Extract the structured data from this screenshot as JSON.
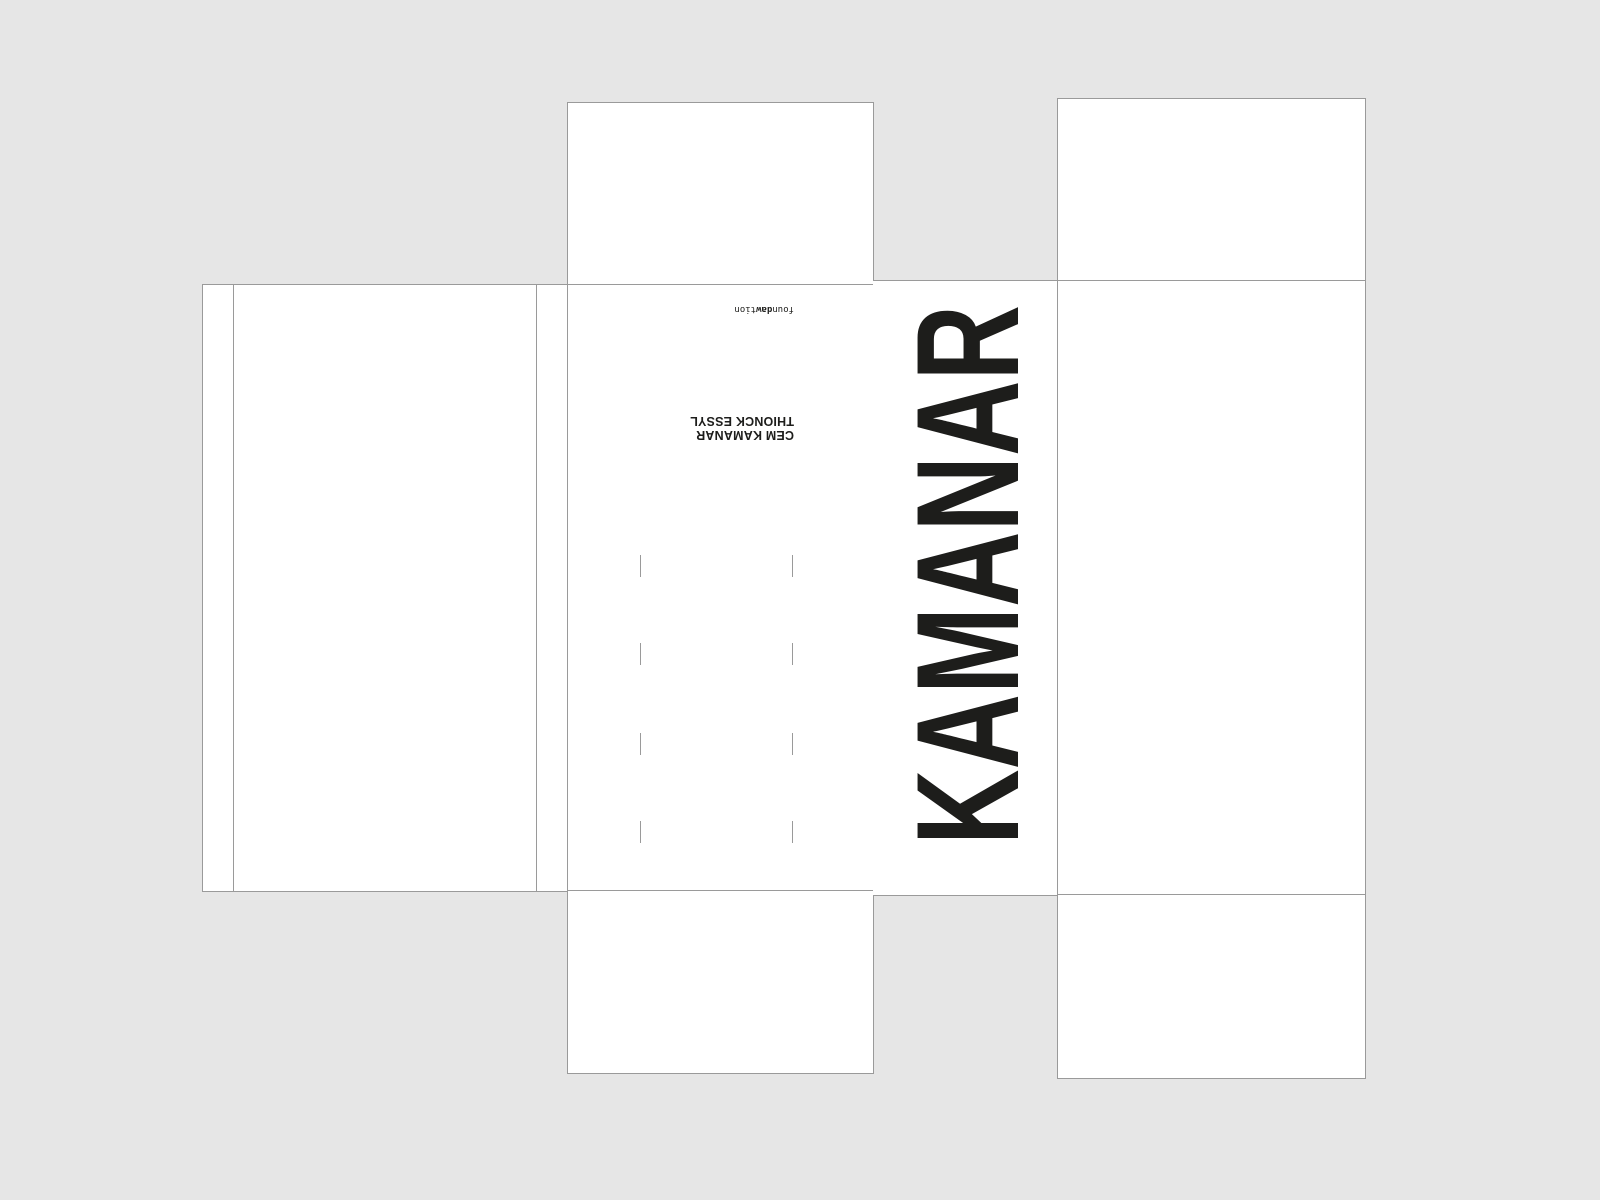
{
  "title_wordmark": "KAMANAR",
  "credits": {
    "line1": "CEM KAMANAR",
    "line2": "THIONCK ESSYL"
  },
  "brand": {
    "pre": "foun",
    "bold": "daw",
    "post": "tion"
  },
  "colors": {
    "background": "#e6e6e6",
    "panel": "#ffffff",
    "ink": "#1d1d1b",
    "dieline": "#9a9a9a"
  }
}
